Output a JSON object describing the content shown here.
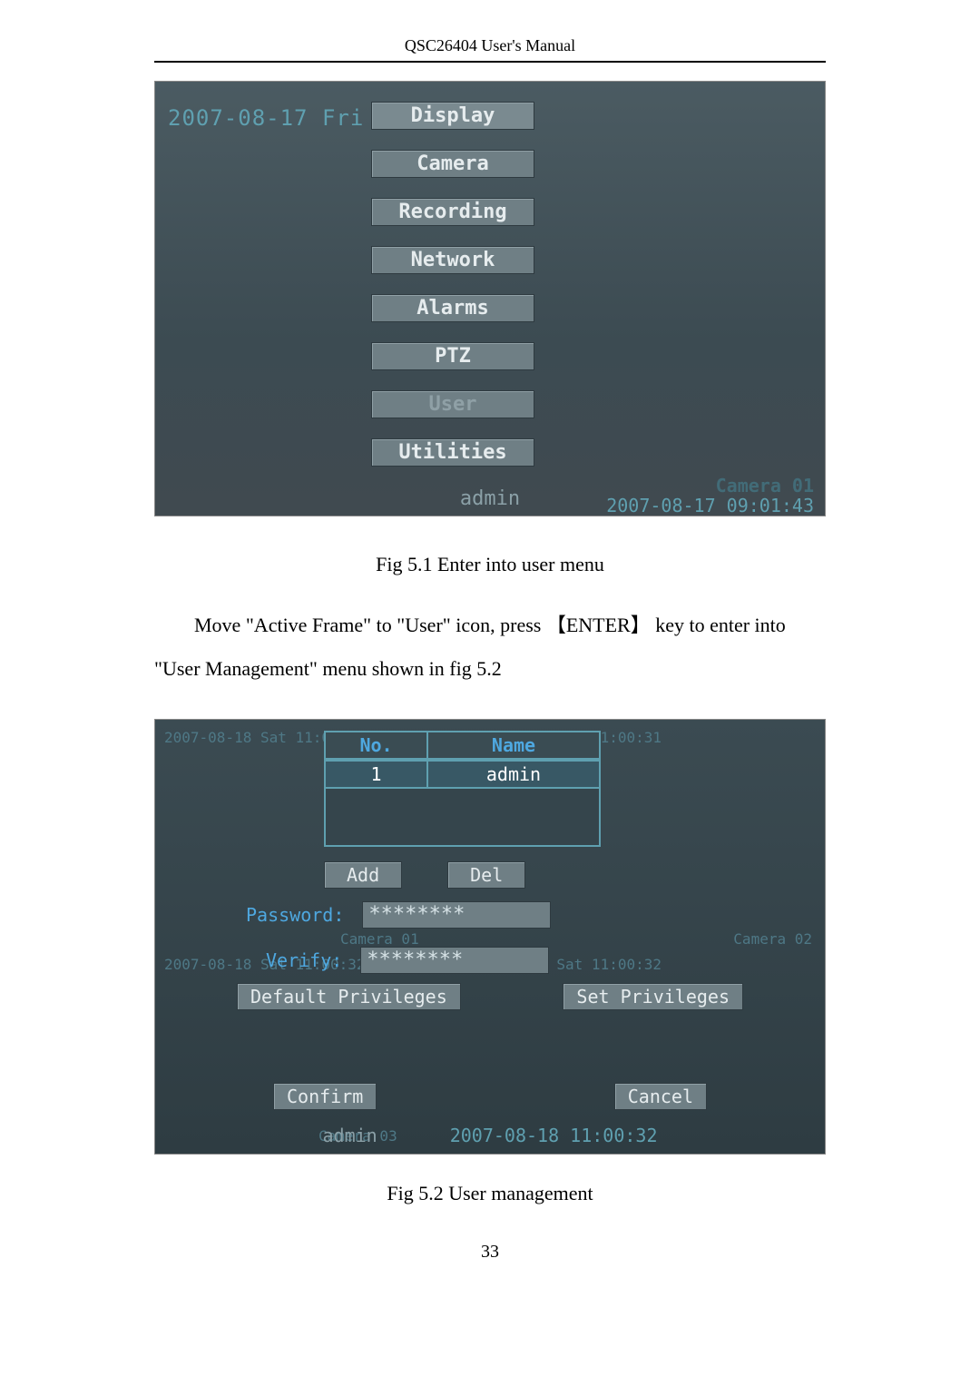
{
  "header": {
    "title": "QSC26404 User's Manual"
  },
  "fig51": {
    "timestamp": "2007-08-17 Fri 09:01:43",
    "menu": [
      "Display",
      "Camera",
      "Recording",
      "Network",
      "Alarms",
      "PTZ",
      "User",
      "Utilities"
    ],
    "selected": "Display",
    "disabled": "User",
    "bottom_user": "admin",
    "camera_label": "Camera 01",
    "bottom_clock": "2007-08-17 09:01:43",
    "caption": "Fig 5.1 Enter into user menu"
  },
  "para": "Move \"Active Frame\" to \"User\" icon, press 【ENTER】 key to enter into \"User Management\" menu shown in fig 5.2",
  "fig52": {
    "quad_ts_tl": "2007-08-18 Sat 11:00:31",
    "quad_ts_tr": "2007-08-18 Sat 11:00:31",
    "quad_ts_bl": "2007-08-18 Sat 11:00:32",
    "quad_ts_br": "2007-08-18 Sat 11:00:32",
    "quad_cam_l": "Camera 01",
    "quad_cam_r": "Camera 02",
    "quad_cam_bl": "Camera 03",
    "table": {
      "headers": [
        "No.",
        "Name"
      ],
      "rows": [
        [
          "1",
          "admin"
        ]
      ]
    },
    "buttons": {
      "add": "Add",
      "del": "Del"
    },
    "password_label": "Password:",
    "password_value": "********",
    "verify_label": "Verify:",
    "verify_value": "********",
    "privileges": {
      "default": "Default Privileges",
      "set": "Set Privileges"
    },
    "confirm": "Confirm",
    "cancel": "Cancel",
    "bottom_user": "admin",
    "bottom_clock": "2007-08-18 11:00:32",
    "caption": "Fig 5.2 User management"
  },
  "page_number": "33"
}
